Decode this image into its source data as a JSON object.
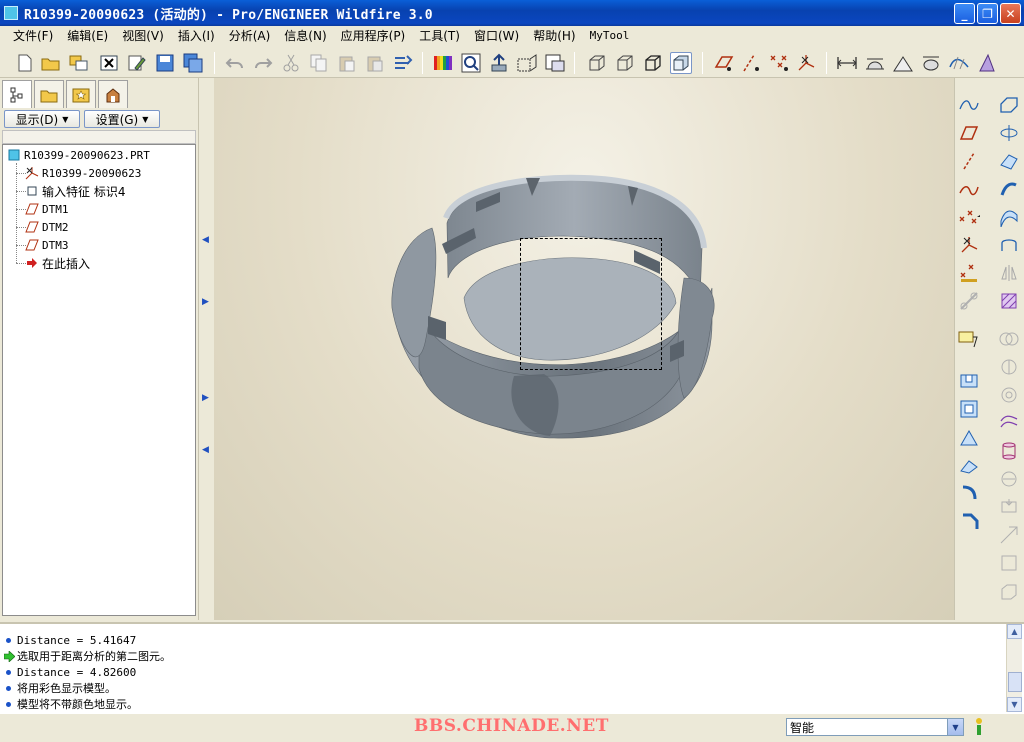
{
  "window": {
    "title": "R10399-20090623 (活动的) - Pro/ENGINEER Wildfire 3.0",
    "min_glyph": "_",
    "max_glyph": "❐",
    "close_glyph": "✕"
  },
  "menu": [
    "文件(F)",
    "编辑(E)",
    "视图(V)",
    "插入(I)",
    "分析(A)",
    "信息(N)",
    "应用程序(P)",
    "工具(T)",
    "窗口(W)",
    "帮助(H)",
    "MyTool"
  ],
  "panel": {
    "display_label": "显示(D)",
    "settings_label": "设置(G)",
    "tree": {
      "root": "R10399-20090623.PRT",
      "items": [
        "R10399-20090623",
        "输入特征 标识4",
        "DTM1",
        "DTM2",
        "DTM3",
        "在此插入"
      ]
    }
  },
  "messages": [
    {
      "kind": "bullet",
      "text": "Distance = 5.41647"
    },
    {
      "kind": "arrow",
      "text": "选取用于距离分析的第二图元。"
    },
    {
      "kind": "bullet",
      "text": "Distance = 4.82600"
    },
    {
      "kind": "bullet",
      "text": "将用彩色显示模型。"
    },
    {
      "kind": "bullet",
      "text": "模型将不带颜色地显示。"
    }
  ],
  "status": {
    "watermark": "BBS.CHINADE.NET",
    "filter_value": "智能"
  },
  "colors": {
    "titlebar": "#0a46c0",
    "model": "#8d959e",
    "viewport_bg": "#e4ddc8",
    "watermark": "#ff6f6f"
  }
}
